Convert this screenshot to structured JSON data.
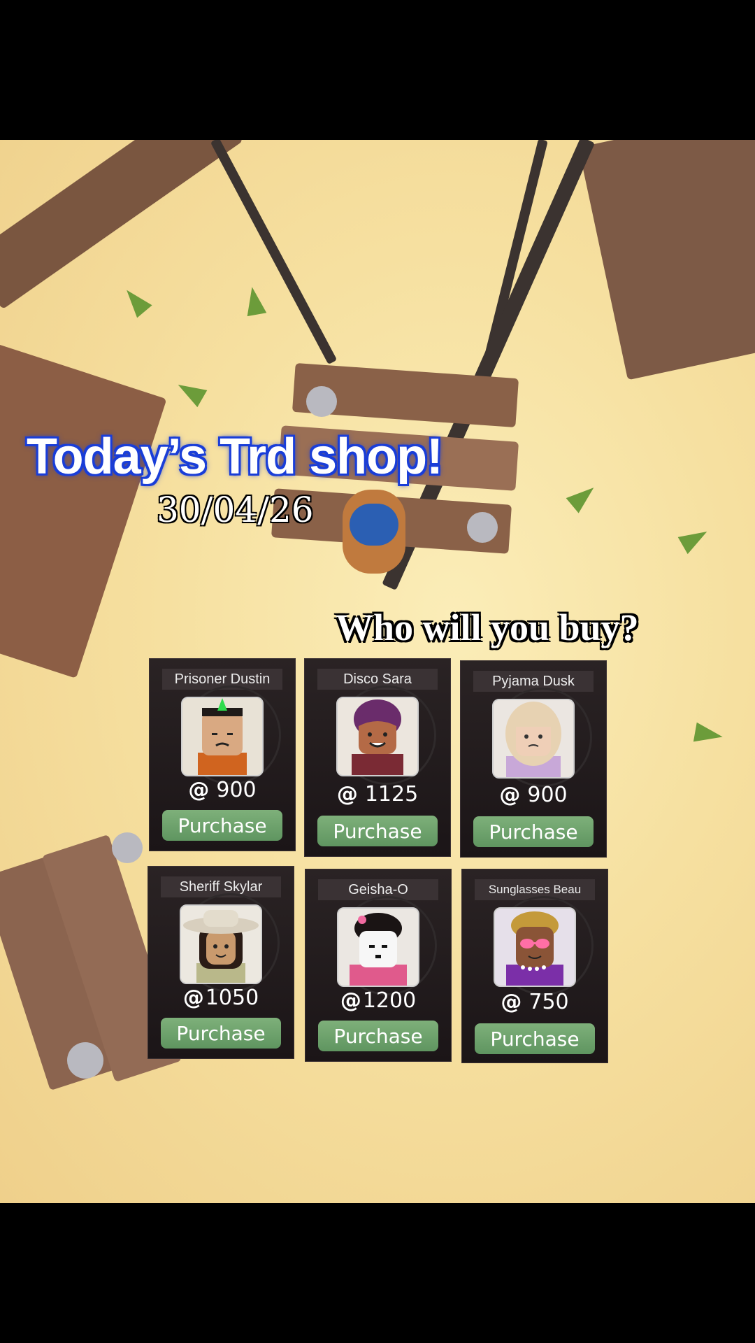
{
  "header": {
    "title": "Today’s Trd shop!",
    "date": "30/04/26",
    "question": "Who will you buy?"
  },
  "shop": {
    "items": [
      {
        "name": "Prisoner Dustin",
        "currency_symbol": "@",
        "price": "900",
        "button": "Purchase",
        "icon": "prisoner-avatar-icon"
      },
      {
        "name": "Disco Sara",
        "currency_symbol": "@",
        "price": "1125",
        "button": "Purchase",
        "icon": "disco-avatar-icon"
      },
      {
        "name": "Pyjama Dusk",
        "currency_symbol": "@",
        "price": "900",
        "button": "Purchase",
        "icon": "pyjama-avatar-icon"
      },
      {
        "name": "Sheriff Skylar",
        "currency_symbol": "@",
        "price": "1050",
        "button": "Purchase",
        "icon": "sheriff-avatar-icon"
      },
      {
        "name": "Geisha-O",
        "currency_symbol": "@",
        "price": "1200",
        "button": "Purchase",
        "icon": "geisha-avatar-icon"
      },
      {
        "name": "Sunglasses Beau",
        "currency_symbol": "@",
        "price": "750",
        "button": "Purchase",
        "icon": "sunglasses-avatar-icon"
      }
    ]
  },
  "colors": {
    "title_glow": "#1b3fd8",
    "card_bg": "#1b1517",
    "button": "#6aa368",
    "sky": "#f6e0a0"
  }
}
